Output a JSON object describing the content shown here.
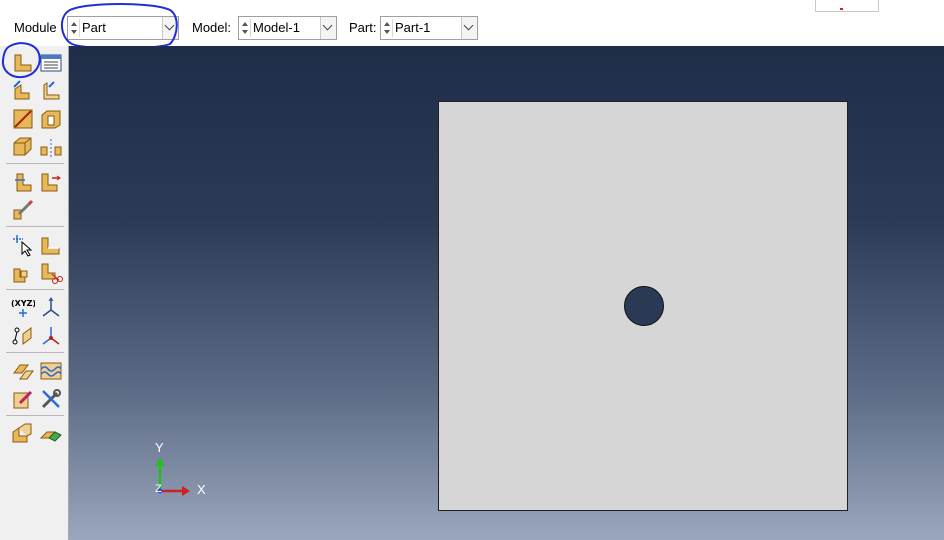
{
  "context_bar": {
    "module_label": "Module",
    "module_value": "Part",
    "model_label": "Model:",
    "model_value": "Model-1",
    "part_label": "Part:",
    "part_value": "Part-1"
  },
  "toolbox": {
    "tools": [
      "create-part-icon",
      "part-manager-icon",
      "create-solid-icon",
      "create-shell-icon",
      "create-wire-icon",
      "create-cut-icon",
      "create-fillet-icon",
      "mirror-icon",
      "partition-face-icon",
      "partition-edge-icon",
      "edit-feature-icon",
      "query-icon",
      "repair-icon",
      "create-datum-point-icon",
      "delete-feature-icon",
      "datum-point-xyz-icon",
      "datum-axis-icon",
      "datum-plane-icon",
      "datum-csys-icon",
      "create-set-icon",
      "create-surface-icon",
      "edit-attribute-icon",
      "tools-icon",
      "merge-instances-icon",
      "assembly-display-icon"
    ]
  },
  "viewport": {
    "triad": {
      "y_label": "Y",
      "x_label": "X",
      "z_label": "Z"
    },
    "colors": {
      "plate": "#d6d6d6",
      "hole": "#2a3a55",
      "annotation": "#1f2fd8"
    }
  }
}
